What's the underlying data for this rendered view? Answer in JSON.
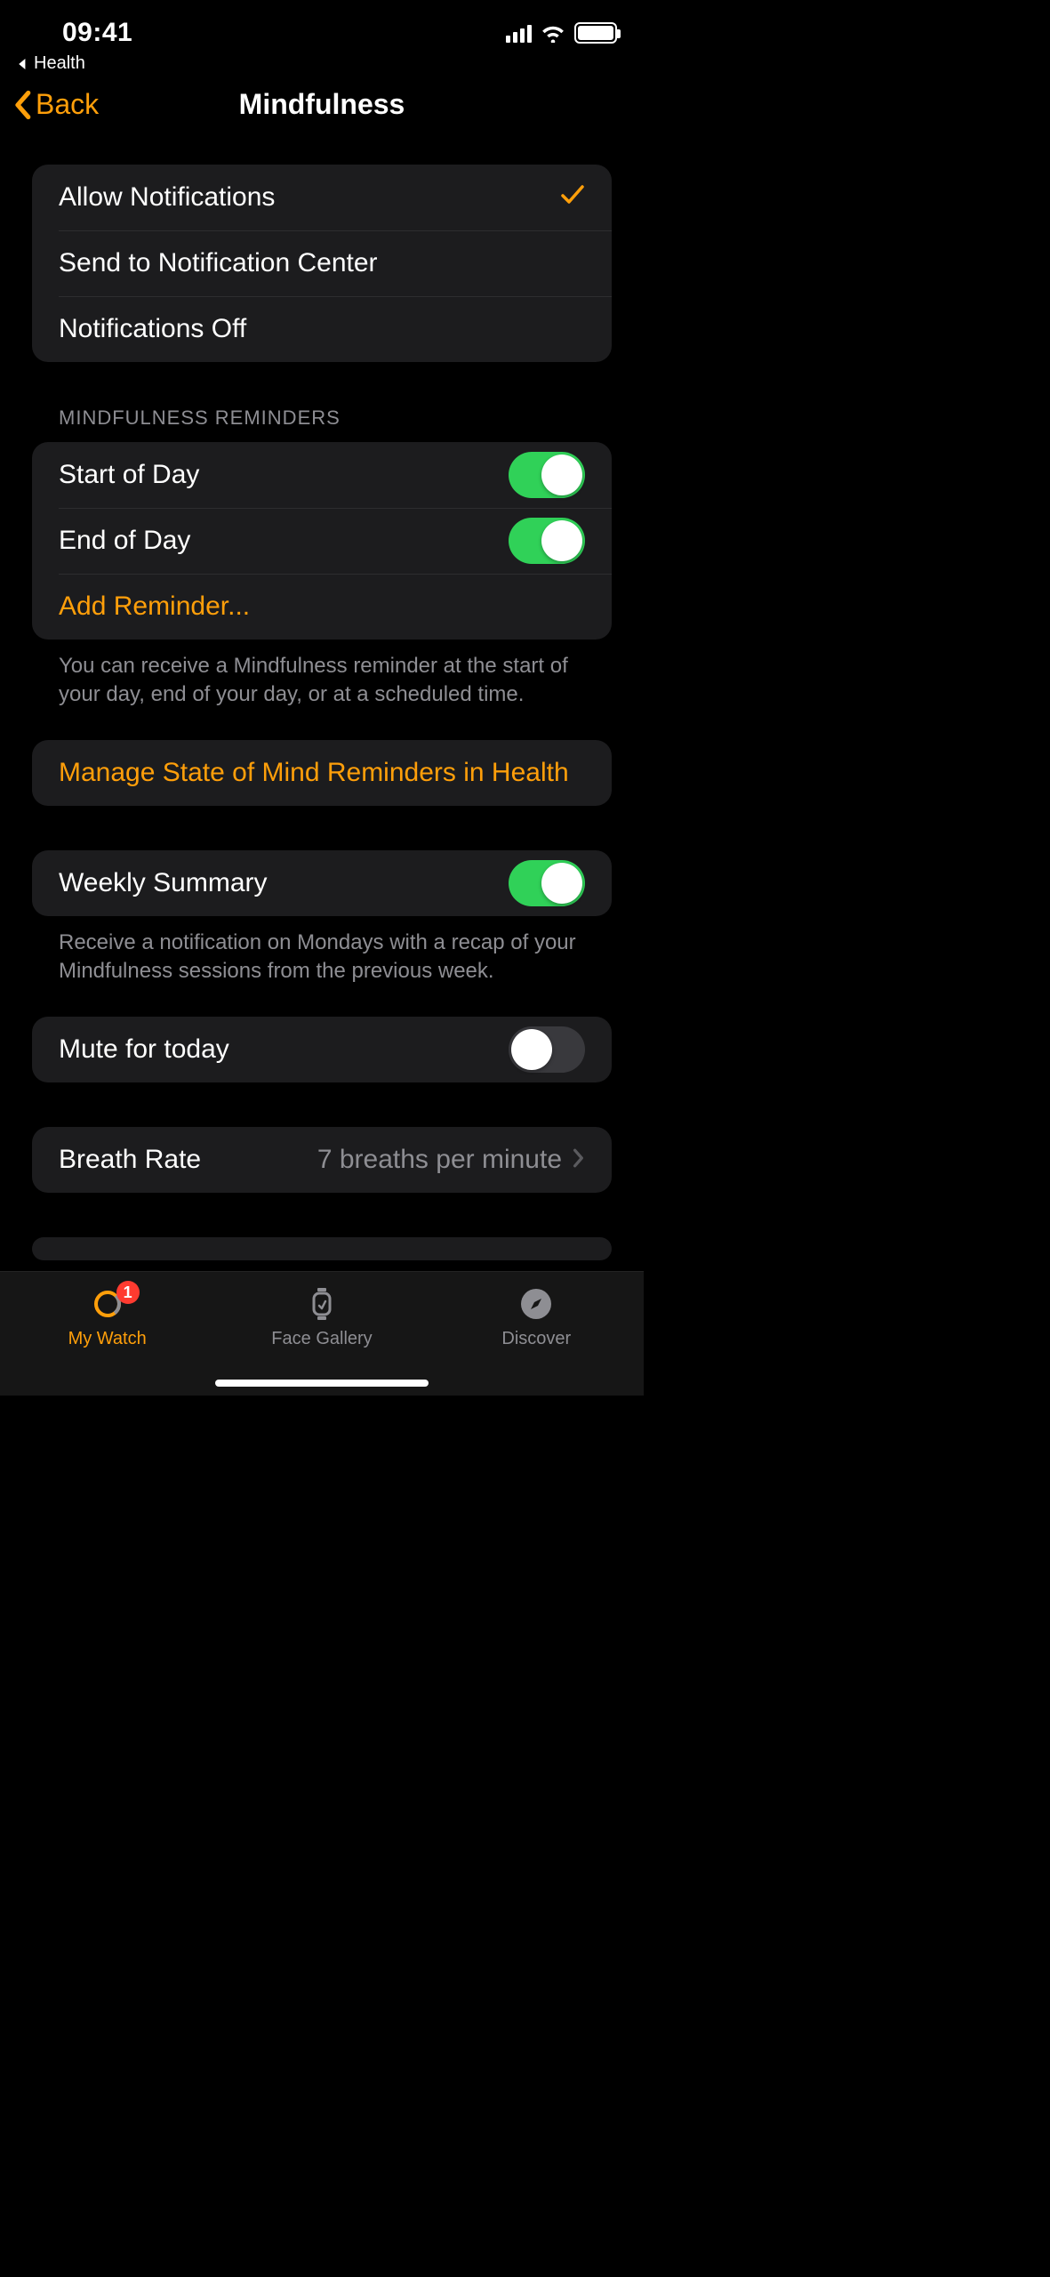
{
  "status": {
    "time": "09:41",
    "breadcrumb": "Health"
  },
  "nav": {
    "back": "Back",
    "title": "Mindfulness"
  },
  "notifications": {
    "allow": "Allow Notifications",
    "send_center": "Send to Notification Center",
    "off": "Notifications Off"
  },
  "reminders": {
    "header": "MINDFULNESS REMINDERS",
    "start": "Start of Day",
    "end": "End of Day",
    "add": "Add Reminder...",
    "footer": "You can receive a Mindfulness reminder at the start of your day, end of your day, or at a scheduled time."
  },
  "state_of_mind": {
    "label": "Manage State of Mind Reminders in Health"
  },
  "weekly": {
    "label": "Weekly Summary",
    "footer": "Receive a notification on Mondays with a recap of your Mindfulness sessions from the previous week."
  },
  "mute": {
    "label": "Mute for today"
  },
  "breath": {
    "label": "Breath Rate",
    "value": "7 breaths per minute"
  },
  "tabs": {
    "my_watch": "My Watch",
    "face_gallery": "Face Gallery",
    "discover": "Discover",
    "badge": "1"
  },
  "toggles": {
    "start_of_day": true,
    "end_of_day": true,
    "weekly_summary": true,
    "mute_today": false
  }
}
